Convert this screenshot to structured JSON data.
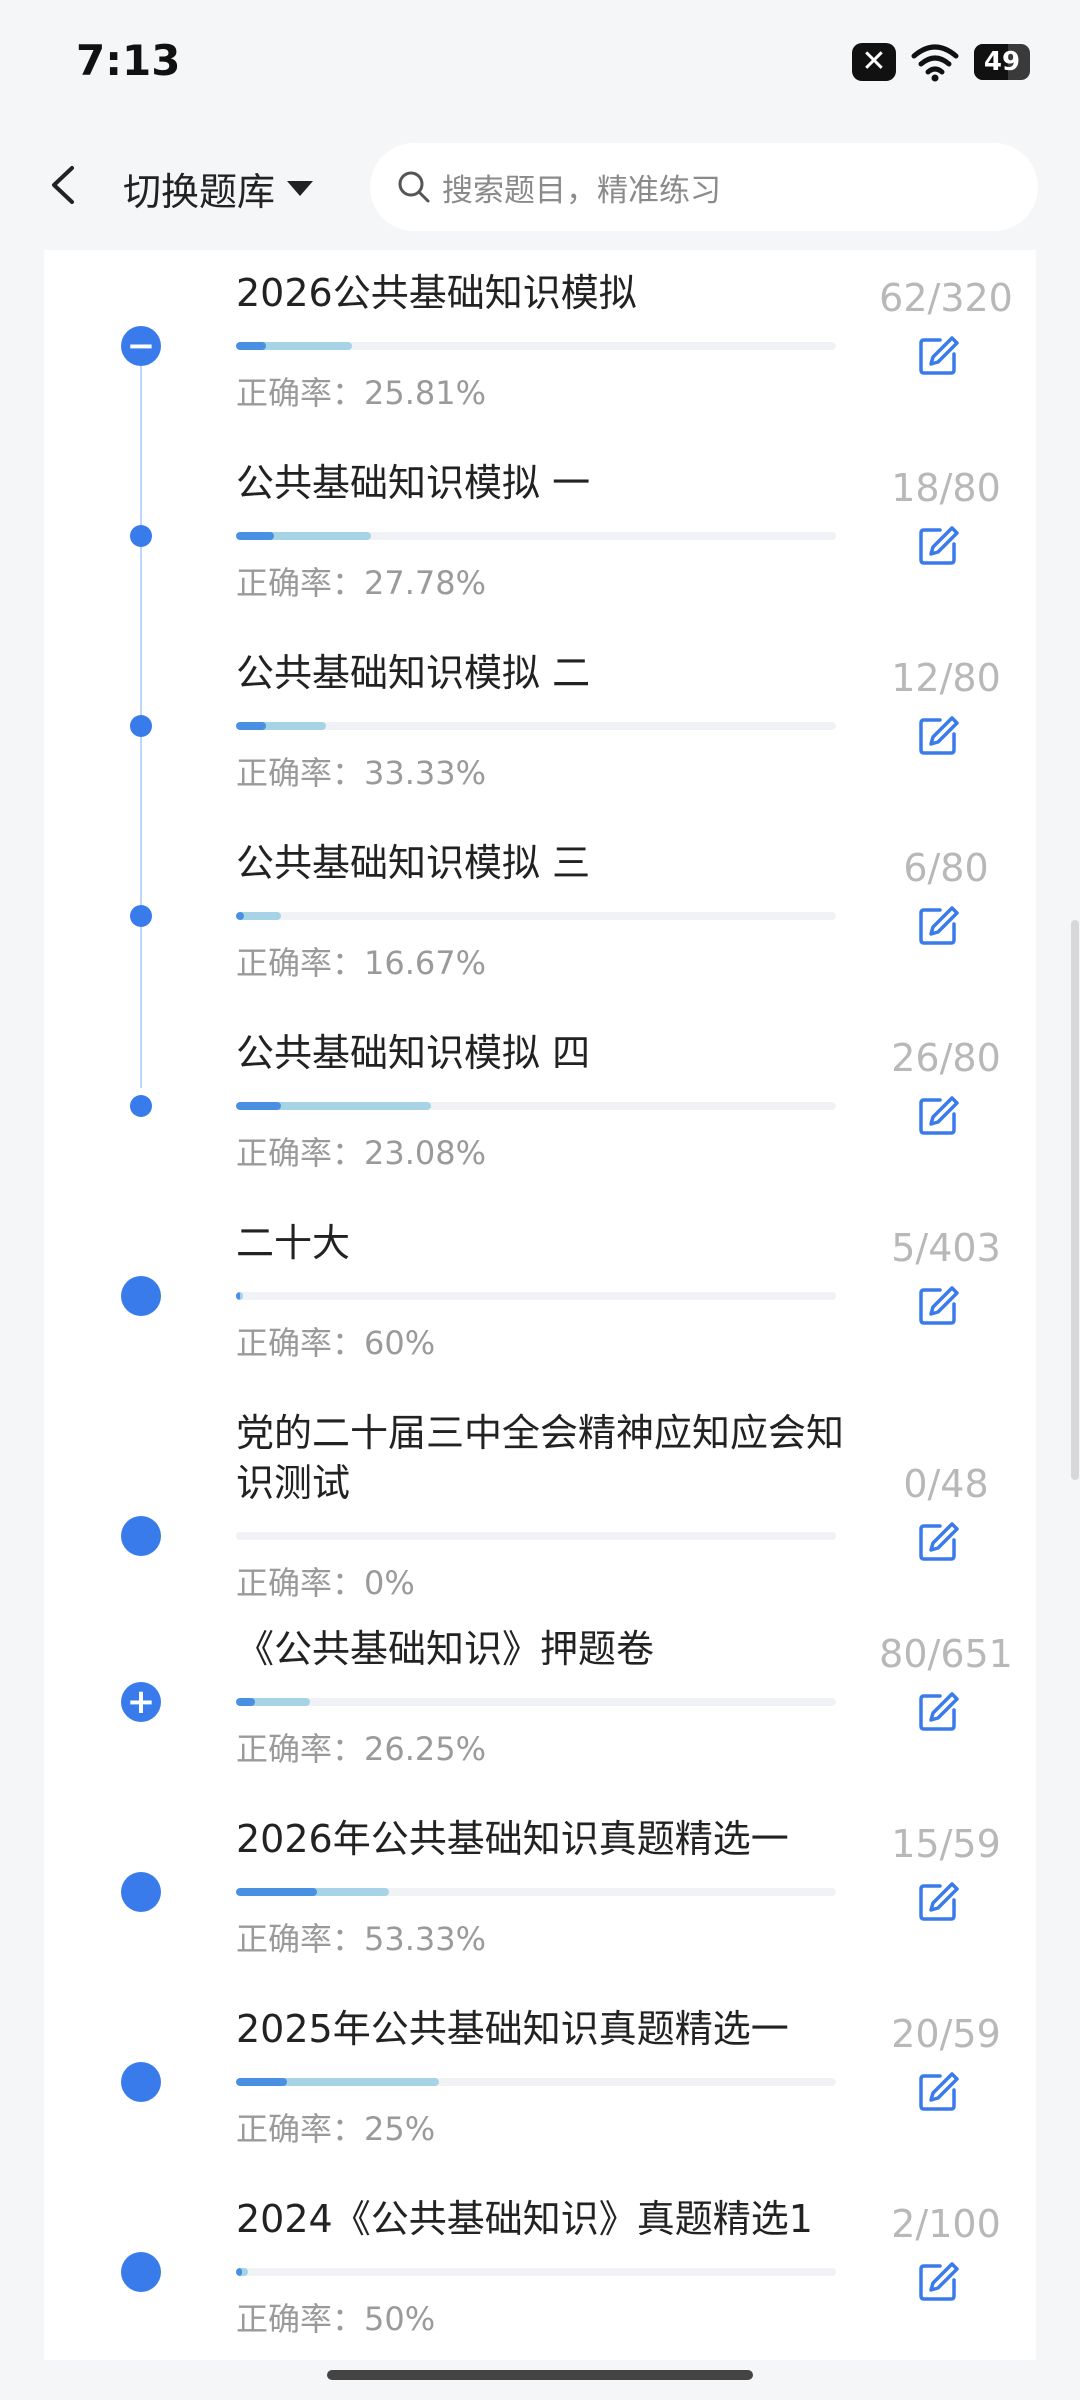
{
  "status_bar": {
    "time": "7:13",
    "battery": "49"
  },
  "header": {
    "library_switch": "切换题库",
    "search_placeholder": "搜索题目，精准练习"
  },
  "items": [
    {
      "title": "2026公共基础知识模拟",
      "done": 62,
      "total": 320,
      "count": "62/320",
      "rate_label": "正确率：25.81%",
      "accuracy": 25.81,
      "node": "minus"
    },
    {
      "title": "公共基础知识模拟 一",
      "done": 18,
      "total": 80,
      "count": "18/80",
      "rate_label": "正确率：27.78%",
      "accuracy": 27.78,
      "node": "small"
    },
    {
      "title": "公共基础知识模拟 二",
      "done": 12,
      "total": 80,
      "count": "12/80",
      "rate_label": "正确率：33.33%",
      "accuracy": 33.33,
      "node": "small"
    },
    {
      "title": "公共基础知识模拟 三",
      "done": 6,
      "total": 80,
      "count": "6/80",
      "rate_label": "正确率：16.67%",
      "accuracy": 16.67,
      "node": "small"
    },
    {
      "title": "公共基础知识模拟 四",
      "done": 26,
      "total": 80,
      "count": "26/80",
      "rate_label": "正确率：23.08%",
      "accuracy": 23.08,
      "node": "small"
    },
    {
      "title": "二十大",
      "done": 5,
      "total": 403,
      "count": "5/403",
      "rate_label": "正确率：60%",
      "accuracy": 60,
      "node": "big"
    },
    {
      "title": "党的二十届三中全会精神应知应会知识测试",
      "done": 0,
      "total": 48,
      "count": "0/48",
      "rate_label": "正确率：0%",
      "accuracy": 0,
      "node": "big"
    },
    {
      "title": "《公共基础知识》押题卷",
      "done": 80,
      "total": 651,
      "count": "80/651",
      "rate_label": "正确率：26.25%",
      "accuracy": 26.25,
      "node": "plus"
    },
    {
      "title": "2026年公共基础知识真题精选一",
      "done": 15,
      "total": 59,
      "count": "15/59",
      "rate_label": "正确率：53.33%",
      "accuracy": 53.33,
      "node": "big"
    },
    {
      "title": "2025年公共基础知识真题精选一",
      "done": 20,
      "total": 59,
      "count": "20/59",
      "rate_label": "正确率：25%",
      "accuracy": 25,
      "node": "big"
    },
    {
      "title": "2024《公共基础知识》真题精选1",
      "done": 2,
      "total": 100,
      "count": "2/100",
      "rate_label": "正确率：50%",
      "accuracy": 50,
      "node": "big"
    }
  ]
}
